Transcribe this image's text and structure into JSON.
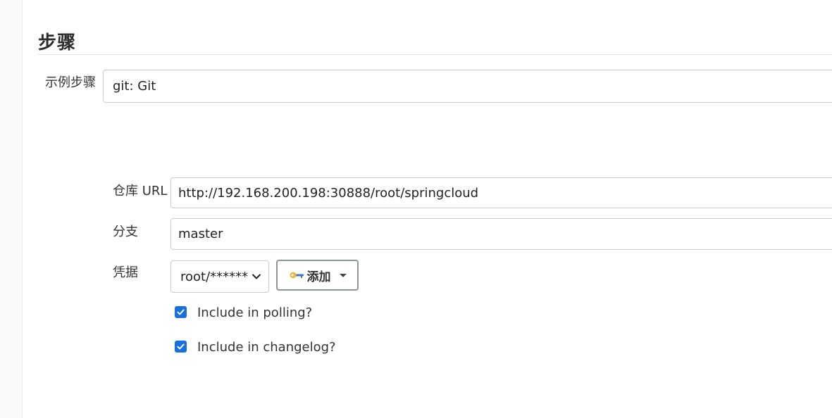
{
  "section": {
    "title": "步骤"
  },
  "sample_step": {
    "label": "示例步骤",
    "value": "git: Git"
  },
  "repo_url": {
    "label": "仓库 URL",
    "value": "http://192.168.200.198:30888/root/springcloud"
  },
  "branch": {
    "label": "分支",
    "value": "master"
  },
  "credentials": {
    "label": "凭据",
    "selected": "root/******",
    "add_button_label": "添加"
  },
  "options": {
    "polling_label": "Include in polling?",
    "polling_checked": true,
    "changelog_label": "Include in changelog?",
    "changelog_checked": true
  },
  "colors": {
    "checkbox": "#1a6fe0",
    "border": "#c9cdd2"
  }
}
